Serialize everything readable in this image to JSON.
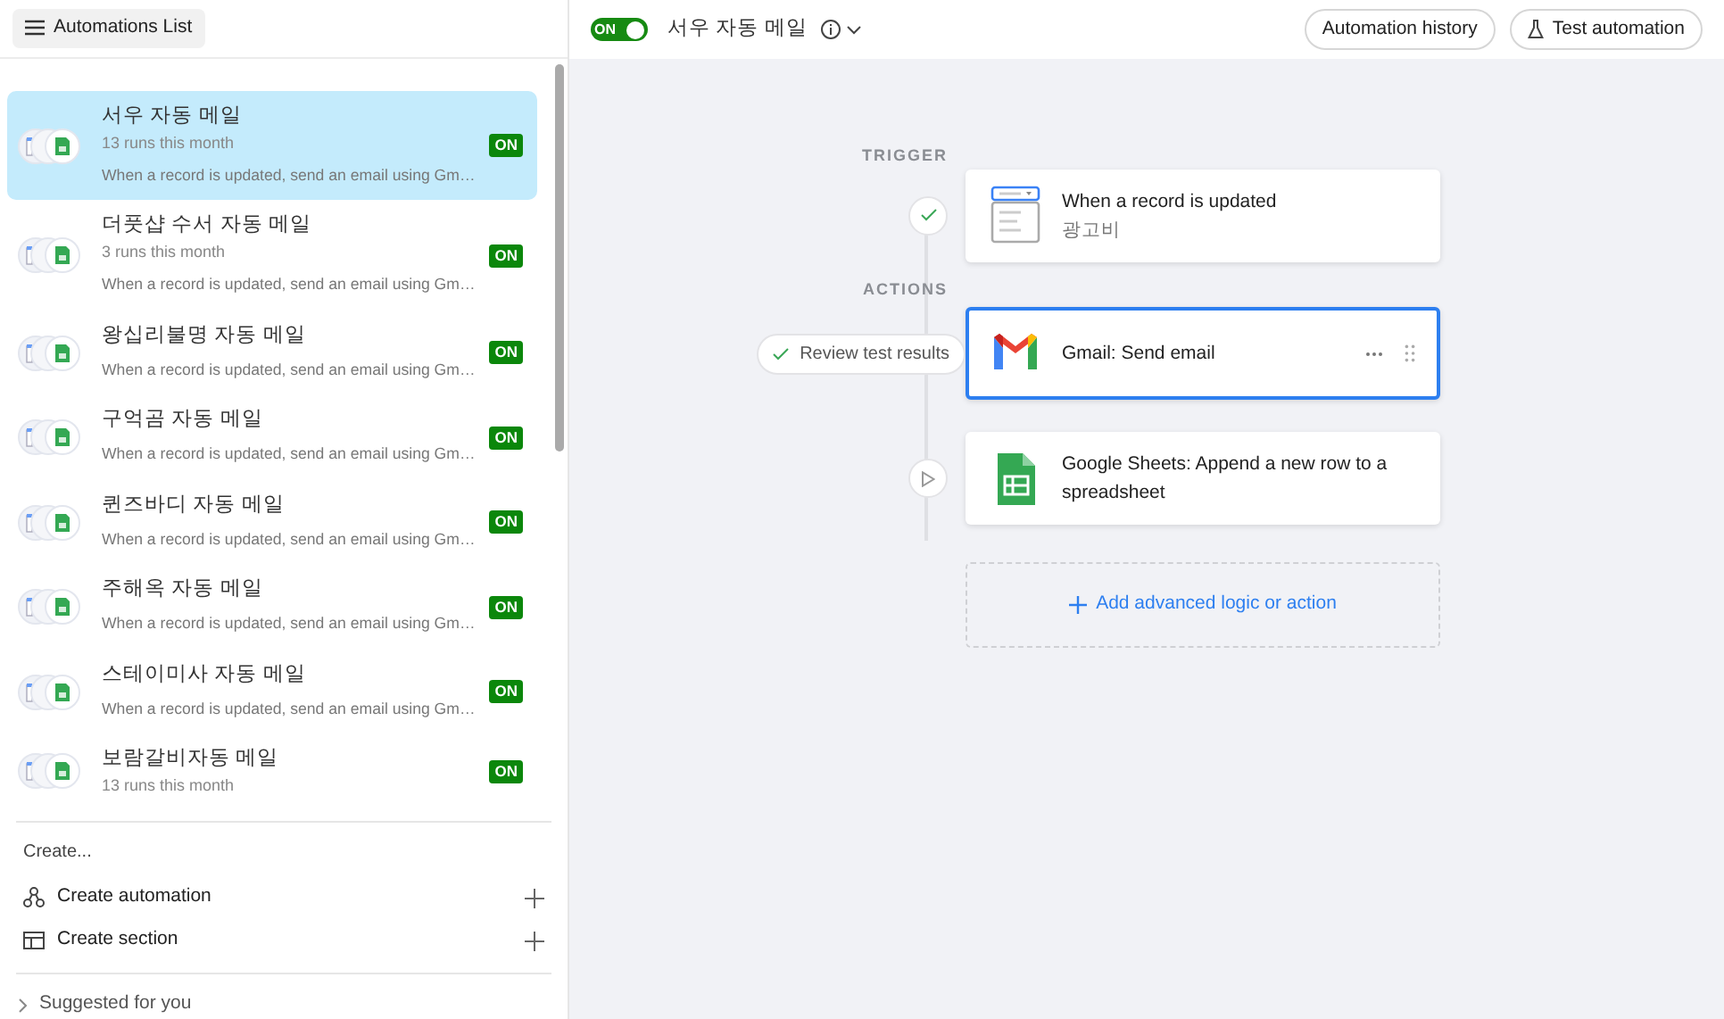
{
  "sidebar": {
    "toggle_label": "Automations List",
    "items": [
      {
        "title": "서우 자동 메일",
        "runs": "13 runs this month",
        "description": "When a record is updated, send an email using Gm…",
        "status": "ON",
        "selected": true
      },
      {
        "title": "더풋샵 수서 자동 메일",
        "runs": "3 runs this month",
        "description": "When a record is updated, send an email using Gm…",
        "status": "ON",
        "selected": false
      },
      {
        "title": "왕십리불명 자동 메일",
        "description": "When a record is updated, send an email using Gm…",
        "status": "ON",
        "selected": false
      },
      {
        "title": "구억곰 자동 메일",
        "description": "When a record is updated, send an email using Gm…",
        "status": "ON",
        "selected": false
      },
      {
        "title": "퀸즈바디 자동 메일",
        "description": "When a record is updated, send an email using Gm…",
        "status": "ON",
        "selected": false
      },
      {
        "title": "주해옥 자동 메일",
        "description": "When a record is updated, send an email using Gm…",
        "status": "ON",
        "selected": false
      },
      {
        "title": "스테이미사 자동 메일",
        "description": "When a record is updated, send an email using Gm…",
        "status": "ON",
        "selected": false
      },
      {
        "title": "보람갈비자동 메일",
        "runs": "13 runs this month",
        "status": "ON",
        "selected": false
      }
    ],
    "create": {
      "heading": "Create...",
      "actions": [
        {
          "label": "Create automation",
          "kind": "automation"
        },
        {
          "label": "Create section",
          "kind": "section"
        }
      ]
    },
    "suggested": {
      "label": "Suggested for you",
      "expanded": false
    }
  },
  "header": {
    "toggle": {
      "label": "ON",
      "on": true
    },
    "title": "서우 자동 메일",
    "buttons": [
      {
        "label": "Automation history",
        "kind": "history"
      },
      {
        "label": "Test automation",
        "kind": "test"
      }
    ]
  },
  "flow": {
    "trigger_label": "TRIGGER",
    "actions_label": "ACTIONS",
    "trigger": {
      "title": "When a record is updated",
      "subtitle": "광고비",
      "test_passed": true
    },
    "actions": [
      {
        "kind": "gmail",
        "title": "Gmail: Send email",
        "test_passed": true,
        "result_label": "Review test results",
        "selected": true
      },
      {
        "kind": "sheets",
        "title": "Google Sheets: Append a new row to a spreadsheet",
        "test_passed": false,
        "selected": false
      }
    ],
    "add_label": "Add advanced logic or action"
  }
}
